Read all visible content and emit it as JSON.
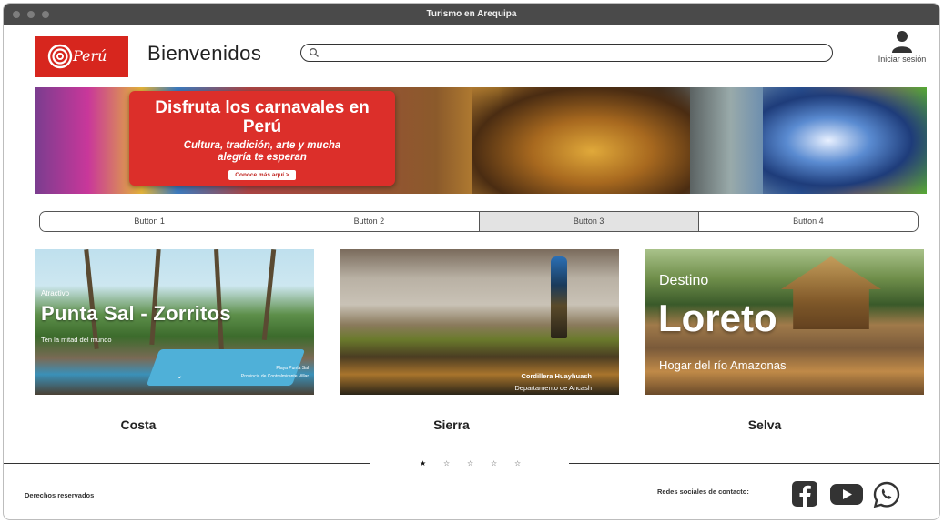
{
  "window": {
    "title": "Turismo en Arequipa"
  },
  "header": {
    "logo_text": "Perú",
    "welcome": "Bienvenidos",
    "search_placeholder": "",
    "login_label": "Iniciar sesión"
  },
  "banner": {
    "title": "Disfruta los carnavales en Perú",
    "subtitle": "Cultura, tradición, arte y mucha alegría te esperan",
    "cta": "Conoce más aquí >"
  },
  "tabs": [
    "Button 1",
    "Button 2",
    "Button 3",
    "Button 4"
  ],
  "tabs_active_index": 2,
  "cards": [
    {
      "eyebrow": "Atractivo",
      "name": "Punta Sal - Zorritos",
      "description": "Ten la mitad del mundo",
      "caption_1": "Playa Punta Sal",
      "caption_2": "Provincia de Contralmirante Villar",
      "label": "Costa"
    },
    {
      "caption_1": "Cordillera Huayhuash",
      "caption_2": "Departamento de Ancash",
      "label": "Sierra"
    },
    {
      "eyebrow": "Destino",
      "name": "Loreto",
      "description": "Hogar del río Amazonas",
      "label": "Selva"
    }
  ],
  "pagination": {
    "count": 5,
    "active_index": 0
  },
  "footer": {
    "rights": "Derechos reservados",
    "social_label": "Redes sociales de contacto:",
    "social_icons": [
      "facebook-icon",
      "youtube-icon",
      "whatsapp-icon"
    ]
  },
  "colors": {
    "brand_red": "#d7261e",
    "titlebar": "#4a4a4a",
    "active_tab": "#e3e3e3"
  }
}
